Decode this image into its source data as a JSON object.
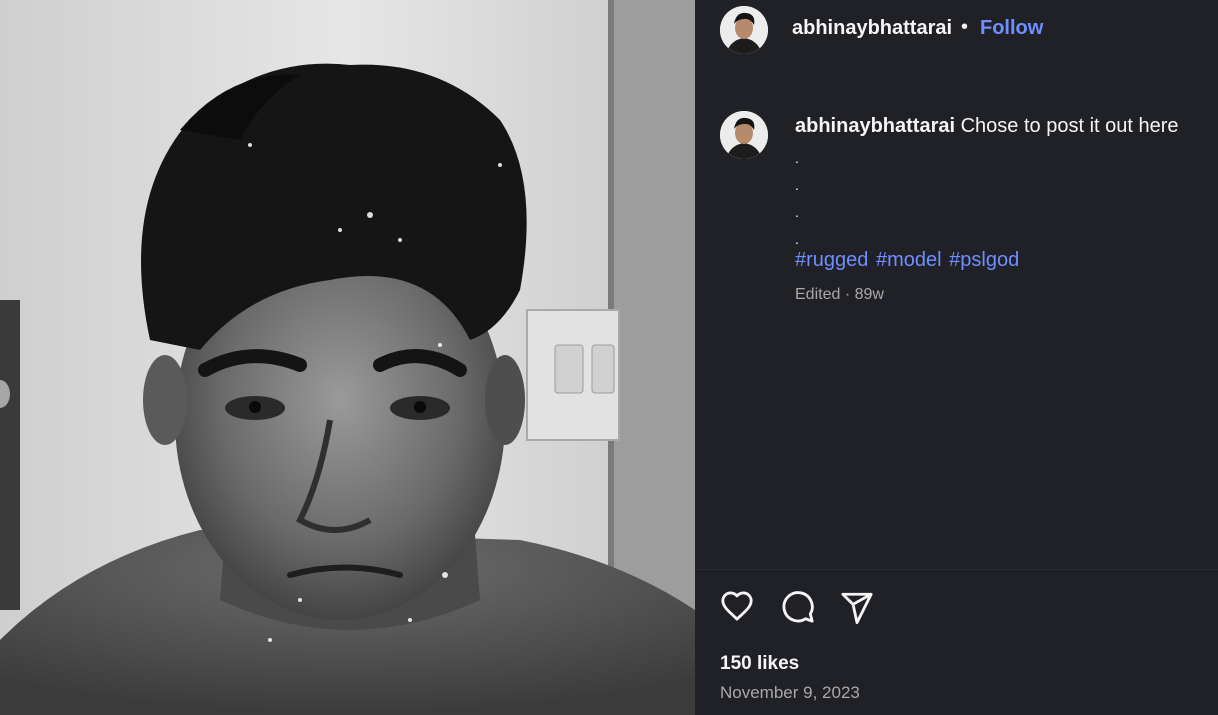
{
  "post": {
    "username": "abhinaybhattarai",
    "separator": "•",
    "follow_label": "Follow",
    "photo_alt": "photo"
  },
  "caption": {
    "username": "abhinaybhattarai",
    "text": "Chose to post it out here",
    "dot_lines": [
      ".",
      ".",
      ".",
      "."
    ],
    "hashtags": [
      "#rugged",
      "#model",
      "#pslgod"
    ],
    "meta": "Edited · 89w"
  },
  "actions": {
    "like_icon": "heart-icon",
    "comment_icon": "comment-icon",
    "share_icon": "send-icon"
  },
  "stats": {
    "likes": "150 likes",
    "date": "November 9, 2023"
  },
  "colors": {
    "panel_bg": "#202127",
    "link": "#6f8eff",
    "muted": "#a8a8a8"
  }
}
